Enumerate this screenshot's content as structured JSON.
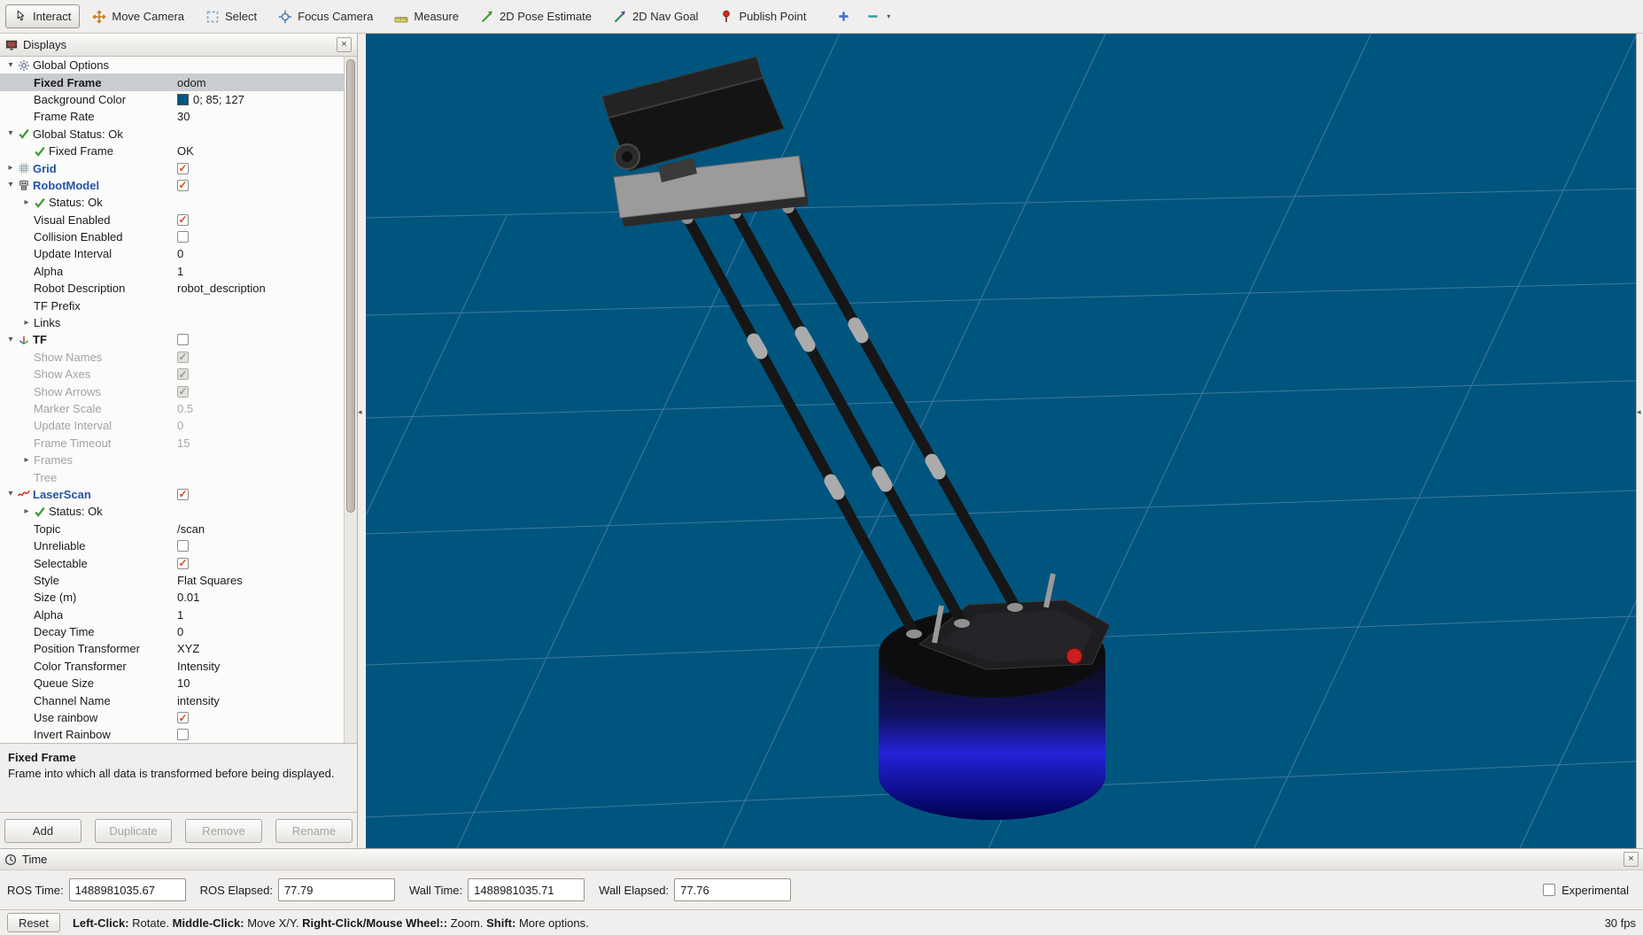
{
  "glyphs": {
    "expander_down": "▾",
    "expander_right": "▸",
    "check": "✓",
    "close": "×",
    "dropdown": "▾",
    "splitter": "◂"
  },
  "toolbar": {
    "tools": [
      {
        "id": "interact",
        "label": "Interact",
        "active": true
      },
      {
        "id": "move-camera",
        "label": "Move Camera"
      },
      {
        "id": "select",
        "label": "Select"
      },
      {
        "id": "focus-camera",
        "label": "Focus Camera"
      },
      {
        "id": "measure",
        "label": "Measure"
      },
      {
        "id": "pose-estimate",
        "label": "2D Pose Estimate"
      },
      {
        "id": "nav-goal",
        "label": "2D Nav Goal"
      },
      {
        "id": "publish-point",
        "label": "Publish Point"
      }
    ]
  },
  "displays_panel": {
    "title": "Displays",
    "rows": [
      {
        "ind": 0,
        "exp": "d",
        "icon": "gear",
        "label": "Global Options"
      },
      {
        "ind": 1,
        "label": "Fixed Frame",
        "sel": true,
        "val": {
          "t": "text",
          "v": "odom"
        }
      },
      {
        "ind": 1,
        "label": "Background Color",
        "val": {
          "t": "color",
          "v": "0; 85; 127",
          "c": "#00557f"
        }
      },
      {
        "ind": 1,
        "label": "Frame Rate",
        "val": {
          "t": "text",
          "v": "30"
        }
      },
      {
        "ind": 0,
        "exp": "d",
        "icon": "check",
        "label": "Global Status: Ok"
      },
      {
        "ind": 1,
        "icon": "check",
        "label": "Fixed Frame",
        "val": {
          "t": "text",
          "v": "OK"
        }
      },
      {
        "ind": 0,
        "exp": "r",
        "icon": "grid",
        "label": "Grid",
        "style": "blue",
        "val": {
          "t": "check",
          "on": true
        }
      },
      {
        "ind": 0,
        "exp": "d",
        "icon": "robot",
        "label": "RobotModel",
        "style": "blue",
        "val": {
          "t": "check",
          "on": true
        }
      },
      {
        "ind": 1,
        "exp": "r",
        "icon": "check",
        "label": "Status: Ok"
      },
      {
        "ind": 1,
        "label": "Visual Enabled",
        "val": {
          "t": "check",
          "on": true
        }
      },
      {
        "ind": 1,
        "label": "Collision Enabled",
        "val": {
          "t": "check",
          "on": false
        }
      },
      {
        "ind": 1,
        "label": "Update Interval",
        "val": {
          "t": "text",
          "v": "0"
        }
      },
      {
        "ind": 1,
        "label": "Alpha",
        "val": {
          "t": "text",
          "v": "1"
        }
      },
      {
        "ind": 1,
        "label": "Robot Description",
        "val": {
          "t": "text",
          "v": "robot_description"
        }
      },
      {
        "ind": 1,
        "label": "TF Prefix"
      },
      {
        "ind": 1,
        "exp": "r",
        "label": "Links"
      },
      {
        "ind": 0,
        "exp": "d",
        "icon": "tf",
        "label": "TF",
        "style": "boldDark",
        "val": {
          "t": "check",
          "on": false
        }
      },
      {
        "ind": 1,
        "label": "Show Names",
        "style": "gray",
        "val": {
          "t": "checkgray",
          "on": true
        }
      },
      {
        "ind": 1,
        "label": "Show Axes",
        "style": "gray",
        "val": {
          "t": "checkgray",
          "on": true
        }
      },
      {
        "ind": 1,
        "label": "Show Arrows",
        "style": "gray",
        "val": {
          "t": "checkgray",
          "on": true
        }
      },
      {
        "ind": 1,
        "label": "Marker Scale",
        "style": "gray",
        "val": {
          "t": "text",
          "v": "0.5"
        }
      },
      {
        "ind": 1,
        "label": "Update Interval",
        "style": "gray",
        "val": {
          "t": "text",
          "v": "0"
        }
      },
      {
        "ind": 1,
        "label": "Frame Timeout",
        "style": "gray",
        "val": {
          "t": "text",
          "v": "15"
        }
      },
      {
        "ind": 1,
        "exp": "r",
        "label": "Frames",
        "style": "gray"
      },
      {
        "ind": 1,
        "label": "Tree",
        "style": "gray"
      },
      {
        "ind": 0,
        "exp": "d",
        "icon": "laser",
        "label": "LaserScan",
        "style": "blue",
        "val": {
          "t": "check",
          "on": true
        }
      },
      {
        "ind": 1,
        "exp": "r",
        "icon": "check",
        "label": "Status: Ok"
      },
      {
        "ind": 1,
        "label": "Topic",
        "val": {
          "t": "text",
          "v": "/scan"
        }
      },
      {
        "ind": 1,
        "label": "Unreliable",
        "val": {
          "t": "check",
          "on": false
        }
      },
      {
        "ind": 1,
        "label": "Selectable",
        "val": {
          "t": "check",
          "on": true
        }
      },
      {
        "ind": 1,
        "label": "Style",
        "val": {
          "t": "text",
          "v": "Flat Squares"
        }
      },
      {
        "ind": 1,
        "label": "Size (m)",
        "val": {
          "t": "text",
          "v": "0.01"
        }
      },
      {
        "ind": 1,
        "label": "Alpha",
        "val": {
          "t": "text",
          "v": "1"
        }
      },
      {
        "ind": 1,
        "label": "Decay Time",
        "val": {
          "t": "text",
          "v": "0"
        }
      },
      {
        "ind": 1,
        "label": "Position Transformer",
        "val": {
          "t": "text",
          "v": "XYZ"
        }
      },
      {
        "ind": 1,
        "label": "Color Transformer",
        "val": {
          "t": "text",
          "v": "Intensity"
        }
      },
      {
        "ind": 1,
        "label": "Queue Size",
        "val": {
          "t": "text",
          "v": "10"
        }
      },
      {
        "ind": 1,
        "label": "Channel Name",
        "val": {
          "t": "text",
          "v": "intensity"
        }
      },
      {
        "ind": 1,
        "label": "Use rainbow",
        "val": {
          "t": "check",
          "on": true
        }
      },
      {
        "ind": 1,
        "label": "Invert Rainbow",
        "val": {
          "t": "check",
          "on": false
        }
      }
    ],
    "description": {
      "title": "Fixed Frame",
      "body": "Frame into which all data is transformed before being displayed."
    },
    "buttons": [
      {
        "id": "add",
        "label": "Add",
        "enabled": true
      },
      {
        "id": "duplicate",
        "label": "Duplicate",
        "enabled": false
      },
      {
        "id": "remove",
        "label": "Remove",
        "enabled": false
      },
      {
        "id": "rename",
        "label": "Rename",
        "enabled": false
      }
    ]
  },
  "time_panel": {
    "title": "Time",
    "fields": [
      {
        "label": "ROS Time:",
        "value": "1488981035.67"
      },
      {
        "label": "ROS Elapsed:",
        "value": "77.79"
      },
      {
        "label": "Wall Time:",
        "value": "1488981035.71"
      },
      {
        "label": "Wall Elapsed:",
        "value": "77.76"
      }
    ],
    "experimental_label": "Experimental",
    "experimental_checked": false
  },
  "status_bar": {
    "reset_label": "Reset",
    "hints": [
      {
        "bold": "Left-Click:",
        "text": " Rotate. "
      },
      {
        "bold": "Middle-Click:",
        "text": " Move X/Y. "
      },
      {
        "bold": "Right-Click/Mouse Wheel::",
        "text": " Zoom. "
      },
      {
        "bold": "Shift:",
        "text": " More options."
      }
    ],
    "fps": "30 fps"
  },
  "viewport": {
    "fixed_frame": "odom",
    "background_color": "#00557f",
    "grid_color": "#4b80a1"
  },
  "colors": {
    "selection": "#c9ccd0",
    "display_name_blue": "#2554a3",
    "status_green": "#3d9b35",
    "check_orange": "#d9481c",
    "robot_base_blue": "#2222d8",
    "robot_button_red": "#c81f1f"
  }
}
